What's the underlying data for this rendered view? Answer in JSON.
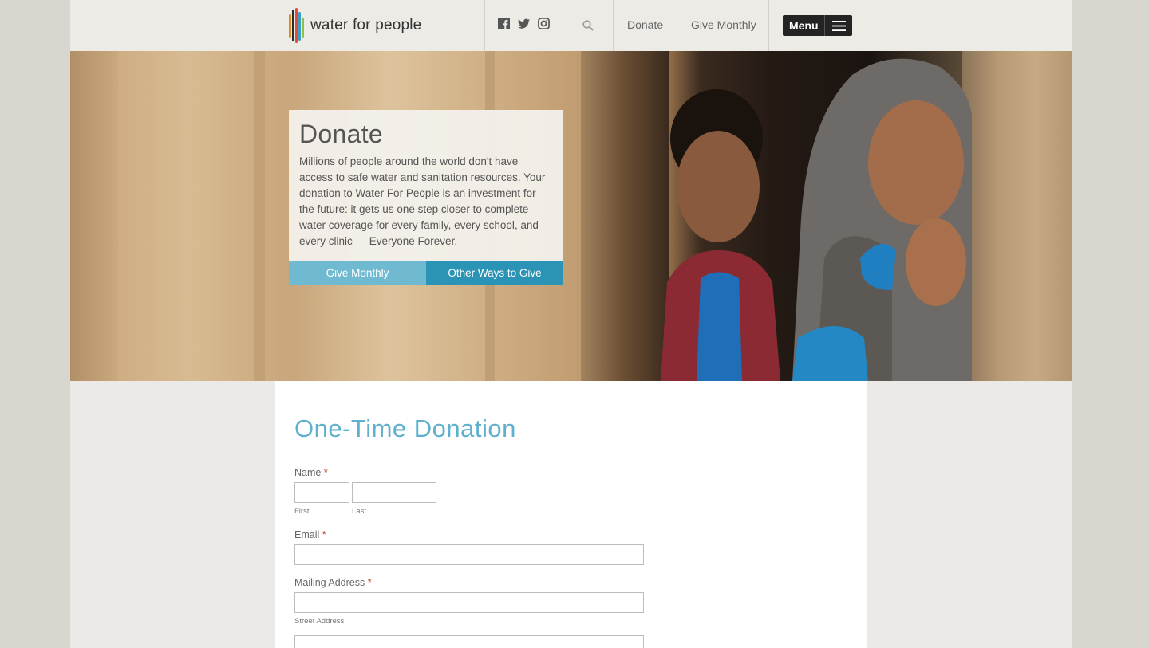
{
  "header": {
    "logo_text": "water for people",
    "nav_donate": "Donate",
    "nav_give_monthly": "Give Monthly",
    "menu_label": "Menu",
    "icons": [
      "facebook-icon",
      "twitter-icon",
      "instagram-icon",
      "search-icon",
      "hamburger-icon"
    ]
  },
  "hero": {
    "title": "Donate",
    "body": "Millions of people around the world don't have access to safe water and sanitation resources. Your donation to Water For People is an investment for the future: it gets us one step closer to complete water coverage for every family, every school, and every clinic — Everyone Forever.",
    "btn_give_monthly": "Give Monthly",
    "btn_other_ways": "Other Ways to Give"
  },
  "form": {
    "title": "One-Time Donation",
    "name_label": "Name",
    "required_mark": "*",
    "first_sub": "First",
    "last_sub": "Last",
    "email_label": "Email",
    "address_label": "Mailing Address",
    "street_sub": "Street Address"
  },
  "colors": {
    "accent_blue": "#5fb0cc",
    "btn_light": "#6fb9d1",
    "btn_dark": "#2b93b5",
    "menu_bg": "#232323"
  }
}
